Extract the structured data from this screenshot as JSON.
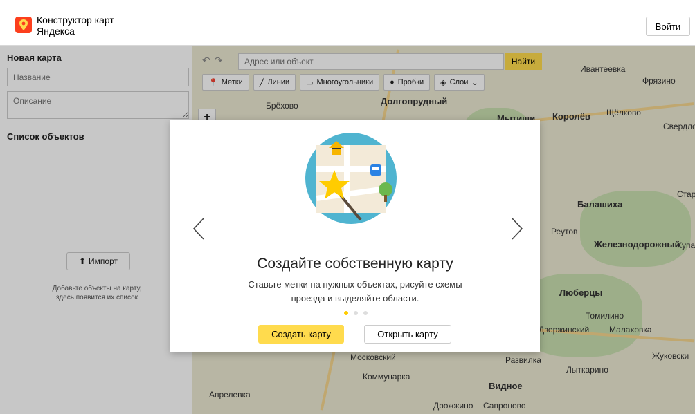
{
  "header": {
    "brand_line1": "Конструктор карт",
    "brand_line2": "Яндекса",
    "login_label": "Войти"
  },
  "sidebar": {
    "title": "Новая карта",
    "name_placeholder": "Название",
    "desc_placeholder": "Описание",
    "list_title": "Список объектов",
    "import_label": "Импорт",
    "hint_line1": "Добавьте объекты на карту,",
    "hint_line2": "здесь появится их список"
  },
  "map": {
    "search_placeholder": "Адрес или объект",
    "find_label": "Найти",
    "tools": [
      {
        "label": "Метки",
        "icon": "pin-icon"
      },
      {
        "label": "Линии",
        "icon": "line-icon"
      },
      {
        "label": "Многоугольники",
        "icon": "polygon-icon"
      },
      {
        "label": "Пробки",
        "icon": "traffic-icon"
      },
      {
        "label": "Слои",
        "icon": "layers-icon"
      }
    ],
    "places": [
      "Ивантеевка",
      "Фрязино",
      "Долгопрудный",
      "Мытищи",
      "Королёв",
      "Щёлково",
      "Свердлов",
      "Балашиха",
      "Реутов",
      "Железнодорожный",
      "Купа",
      "Люберцы",
      "Томилино",
      "Малаховка",
      "Дзержинский",
      "Жуковски",
      "Лыткарино",
      "Развилка",
      "Видное",
      "Дрожжино",
      "Сапроново",
      "Московский",
      "Коммунарка",
      "Апрелевка",
      "Брёхово",
      "Стара"
    ]
  },
  "modal": {
    "title": "Создайте собственную карту",
    "desc_line1": "Ставьте метки на нужных объектах, рисуйте схемы",
    "desc_line2": "проезда и выделяйте области.",
    "create_label": "Создать карту",
    "open_label": "Открыть карту",
    "slide_count": 3,
    "active_slide": 1
  },
  "colors": {
    "accent_yellow": "#ffdb4d",
    "illustration_circle": "#4fb4d0",
    "logo_red": "#fc3f1d"
  }
}
